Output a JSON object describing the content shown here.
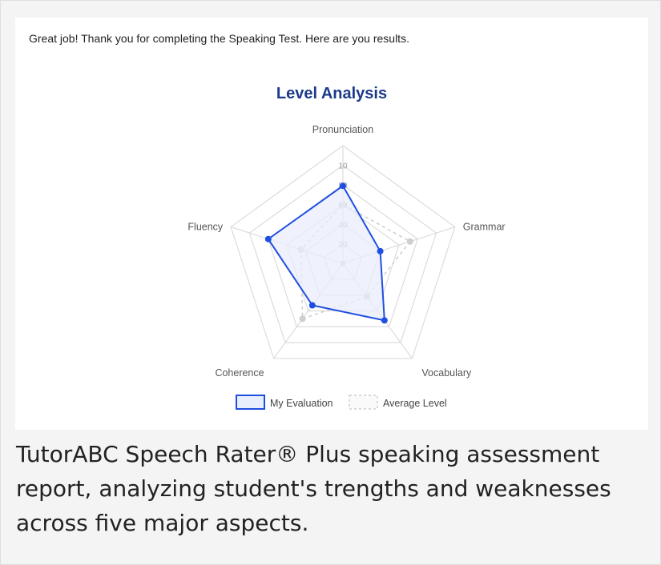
{
  "intro_text": "Great job! Thank you for completing the Speaking Test. Here are you results.",
  "caption": "TutorABC Speech Rater® Plus speaking assessment report, analyzing student's trengths and weaknesses across five major aspects.",
  "colors": {
    "my_evaluation": "#1f4fe0",
    "my_evaluation_fill": "#e9eefc",
    "average_level": "#cfcfcf",
    "title": "#1d3a8a",
    "grid": "#dcdcdc"
  },
  "chart_data": {
    "type": "radar",
    "title": "Level Analysis",
    "axes": [
      "Pronunciation",
      "Grammar",
      "Vocabulary",
      "Coherence",
      "Fluency"
    ],
    "radial_ticks": [
      "0",
      "20",
      "40",
      "60",
      "80",
      "10"
    ],
    "rlim": [
      0,
      120
    ],
    "grid": true,
    "legend_position": "bottom",
    "series": [
      {
        "name": "My Evaluation",
        "values": [
          79,
          40,
          72,
          53,
          80
        ]
      },
      {
        "name": "Average Level",
        "values": [
          60,
          72,
          42,
          70,
          45
        ]
      }
    ]
  }
}
